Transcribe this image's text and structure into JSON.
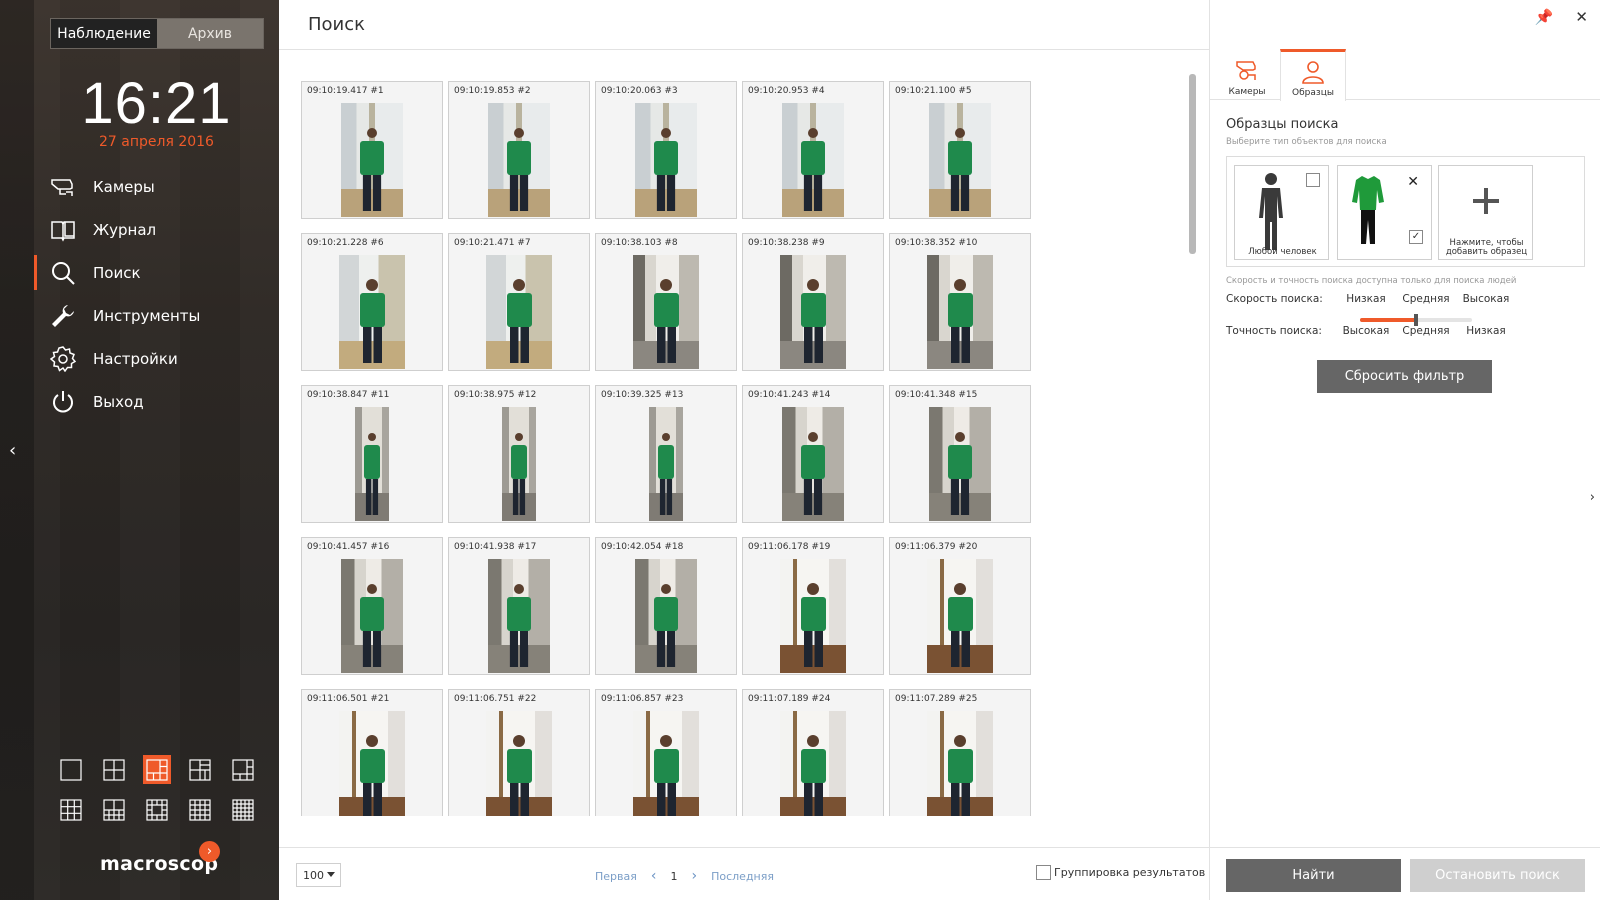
{
  "colors": {
    "accent": "#ef5a2a",
    "sidebar": "#2e2925",
    "shirt": "#1f8a4c"
  },
  "sidebar": {
    "mode_tabs": [
      "Наблюдение",
      "Архив"
    ],
    "clock": "16:21",
    "date": "27 апреля 2016",
    "nav": [
      {
        "label": "Камеры",
        "icon": "camera-icon"
      },
      {
        "label": "Журнал",
        "icon": "book-icon"
      },
      {
        "label": "Поиск",
        "icon": "search-icon"
      },
      {
        "label": "Инструменты",
        "icon": "wrench-icon"
      },
      {
        "label": "Настройки",
        "icon": "gear-icon"
      },
      {
        "label": "Выход",
        "icon": "power-icon"
      }
    ],
    "logo": "macroscop"
  },
  "main": {
    "title": "Поиск",
    "results": [
      {
        "label": "09:10:19.417 #1",
        "scene": "office"
      },
      {
        "label": "09:10:19.853 #2",
        "scene": "office"
      },
      {
        "label": "09:10:20.063 #3",
        "scene": "office"
      },
      {
        "label": "09:10:20.953 #4",
        "scene": "office"
      },
      {
        "label": "09:10:21.100 #5",
        "scene": "office"
      },
      {
        "label": "09:10:21.228 #6",
        "scene": "office-wide"
      },
      {
        "label": "09:10:21.471 #7",
        "scene": "office-wide"
      },
      {
        "label": "09:10:38.103 #8",
        "scene": "corridor-wide"
      },
      {
        "label": "09:10:38.238 #9",
        "scene": "corridor-wide"
      },
      {
        "label": "09:10:38.352 #10",
        "scene": "corridor-wide"
      },
      {
        "label": "09:10:38.847 #11",
        "scene": "corridor-narrow"
      },
      {
        "label": "09:10:38.975 #12",
        "scene": "corridor-narrow"
      },
      {
        "label": "09:10:39.325 #13",
        "scene": "corridor-narrow"
      },
      {
        "label": "09:10:41.243 #14",
        "scene": "corridor"
      },
      {
        "label": "09:10:41.348 #15",
        "scene": "corridor"
      },
      {
        "label": "09:10:41.457 #16",
        "scene": "corridor"
      },
      {
        "label": "09:10:41.938 #17",
        "scene": "corridor"
      },
      {
        "label": "09:10:42.054 #18",
        "scene": "corridor"
      },
      {
        "label": "09:11:06.178 #19",
        "scene": "doorway"
      },
      {
        "label": "09:11:06.379 #20",
        "scene": "doorway"
      },
      {
        "label": "09:11:06.501 #21",
        "scene": "doorway"
      },
      {
        "label": "09:11:06.751 #22",
        "scene": "doorway"
      },
      {
        "label": "09:11:06.857 #23",
        "scene": "doorway"
      },
      {
        "label": "09:11:07.189 #24",
        "scene": "doorway"
      },
      {
        "label": "09:11:07.289 #25",
        "scene": "doorway"
      }
    ],
    "per_page": "100",
    "pager": {
      "first": "Первая",
      "current": "1",
      "last": "Последняя"
    },
    "group_label": "Группировка результатов"
  },
  "right": {
    "tabs": [
      {
        "label": "Камеры",
        "icon": "camera-icon"
      },
      {
        "label": "Образцы",
        "icon": "person-icon"
      }
    ],
    "section_title": "Образцы поиска",
    "section_sub": "Выберите тип объектов для поиска",
    "samples": {
      "any_person": "Любой человек",
      "add_sample": "Нажмите, чтобы добавить образец"
    },
    "note": "Скорость и точность поиска доступна только для поиска людей",
    "speed": {
      "label": "Скорость поиска:",
      "options": [
        "Низкая",
        "Средняя",
        "Высокая"
      ],
      "level": 0.5
    },
    "accuracy": {
      "label": "Точность поиска:",
      "options": [
        "Высокая",
        "Средняя",
        "Низкая"
      ]
    },
    "reset": "Сбросить фильтр",
    "find": "Найти",
    "stop": "Остановить поиск"
  }
}
